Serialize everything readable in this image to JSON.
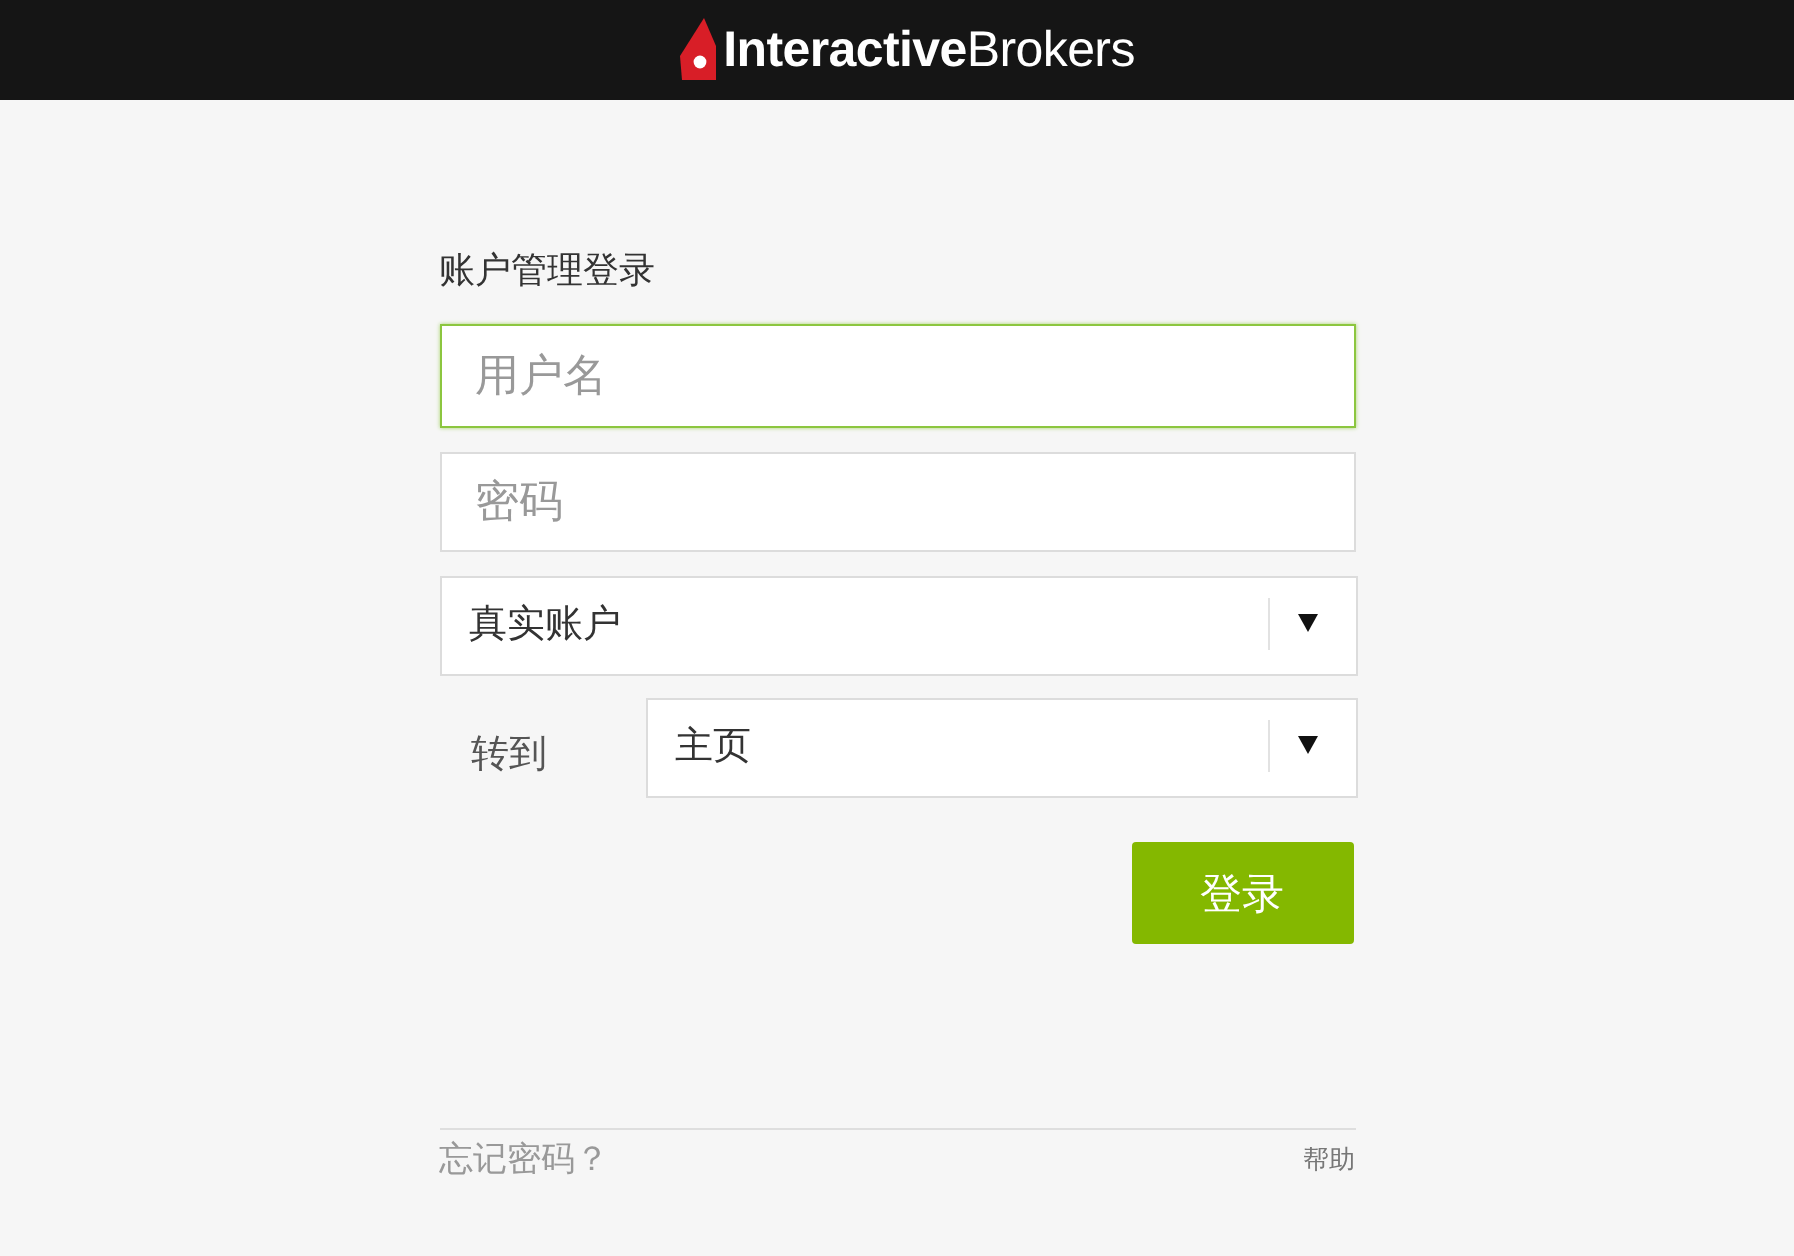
{
  "header": {
    "logo": "**Interactive**Brokers"
  },
  "login": {
    "title": "账户管理登录",
    "username": {
      "placeholder": "用户名",
      "focused": true
    },
    "password": {
      "placeholder": "密码",
      "focused": false
    },
    "account_type": {
      "value": "真实账户"
    },
    "goto": {
      "label": "转到",
      "value": "主页"
    },
    "submit": "登录"
  },
  "footer": {
    "forgot": "忘记密码？",
    "help": "帮助"
  }
}
